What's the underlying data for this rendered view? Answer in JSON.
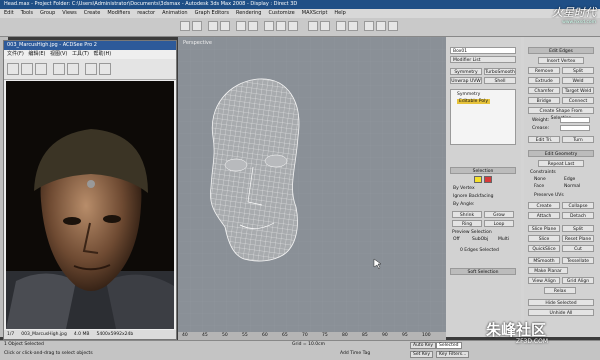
{
  "max_window": {
    "title": "Head.max - Project Folder: C:\\Users\\Administrator\\Documents\\3dsmax - Autodesk 3ds Max 2008 - Display : Direct 3D",
    "menu": [
      "Edit",
      "Tools",
      "Group",
      "Views",
      "Create",
      "Modifiers",
      "reactor",
      "Animation",
      "Graph Editors",
      "Rendering",
      "Customize",
      "MAXScript",
      "Help"
    ]
  },
  "acdsee": {
    "title": "003_MarcusHigh.jpg - ACDSee Pro 2",
    "menu": [
      "文件(F)",
      "编辑(E)",
      "视图(V)",
      "工具(T)",
      "帮助(H)"
    ],
    "status": [
      "1/7",
      "003_MarcusHigh.jpg",
      "4.0 MB",
      "5400x5992x24b"
    ]
  },
  "viewport": {
    "label": "Perspective"
  },
  "modify_panel": {
    "object_name": "Box01",
    "modifier_list": "Modifier List",
    "stack": [
      "Symmetry",
      "Editable Poly"
    ],
    "buttons_row1": [
      "Symmetry",
      "TurboSmooth"
    ],
    "buttons_row2": [
      "Unwrap UVW",
      "Shell"
    ],
    "selection_title": "Selection",
    "selection_options": [
      "By Vertex",
      "Ignore Backfacing",
      "By Angle:"
    ],
    "selection_buttons": [
      "Shrink",
      "Grow",
      "Ring",
      "Loop"
    ],
    "preview_title": "Preview Selection",
    "preview_options": [
      "Off",
      "SubObj",
      "Multi"
    ],
    "selected_status": "0 Edges Selected",
    "soft_selection": "Soft Selection"
  },
  "edit_panel": {
    "edit_edges_title": "Edit Edges",
    "insert_vertex": "Insert Vertex",
    "buttons": [
      "Remove",
      "Split",
      "Extrude",
      "Weld",
      "Chamfer",
      "Target Weld",
      "Bridge",
      "Connect"
    ],
    "create_shape": "Create Shape From Selection",
    "weight_label": "Weight:",
    "crease_label": "Crease:",
    "edit_tri": "Edit Tri.",
    "turn": "Turn",
    "edit_geometry_title": "Edit Geometry",
    "repeat_last": "Repeat Last",
    "constraints": "Constraints",
    "constraint_options": [
      "None",
      "Edge",
      "Face",
      "Normal"
    ],
    "preserve_uvs": "Preserve UVs",
    "geo_buttons": [
      "Create",
      "Collapse",
      "Attach",
      "Detach",
      "Slice Plane",
      "Split",
      "Slice",
      "Reset Plane",
      "QuickSlice",
      "Cut",
      "MSmooth",
      "Tessellate",
      "Make Planar",
      "View Align",
      "Grid Align",
      "Relax"
    ],
    "hide_selected": "Hide Selected",
    "unhide_all": "Unhide All"
  },
  "status": {
    "selected": "1 Object Selected",
    "hint": "Click or click-and-drag to select objects",
    "grid": "Grid = 10.0cm",
    "auto_key": "Auto Key",
    "set_key": "Set Key",
    "key_filters": "Key Filters...",
    "selected_label": "Selected",
    "add_time_tag": "Add Time Tag"
  },
  "timeline_ticks": [
    "40",
    "45",
    "50",
    "55",
    "60",
    "65",
    "70",
    "75",
    "80",
    "85",
    "90",
    "95",
    "100"
  ],
  "watermarks": {
    "top": "火星时代",
    "top_url": "www.hxsd.com",
    "bottom": "朱峰社区",
    "bottom_url": "ZF3D.COM"
  }
}
